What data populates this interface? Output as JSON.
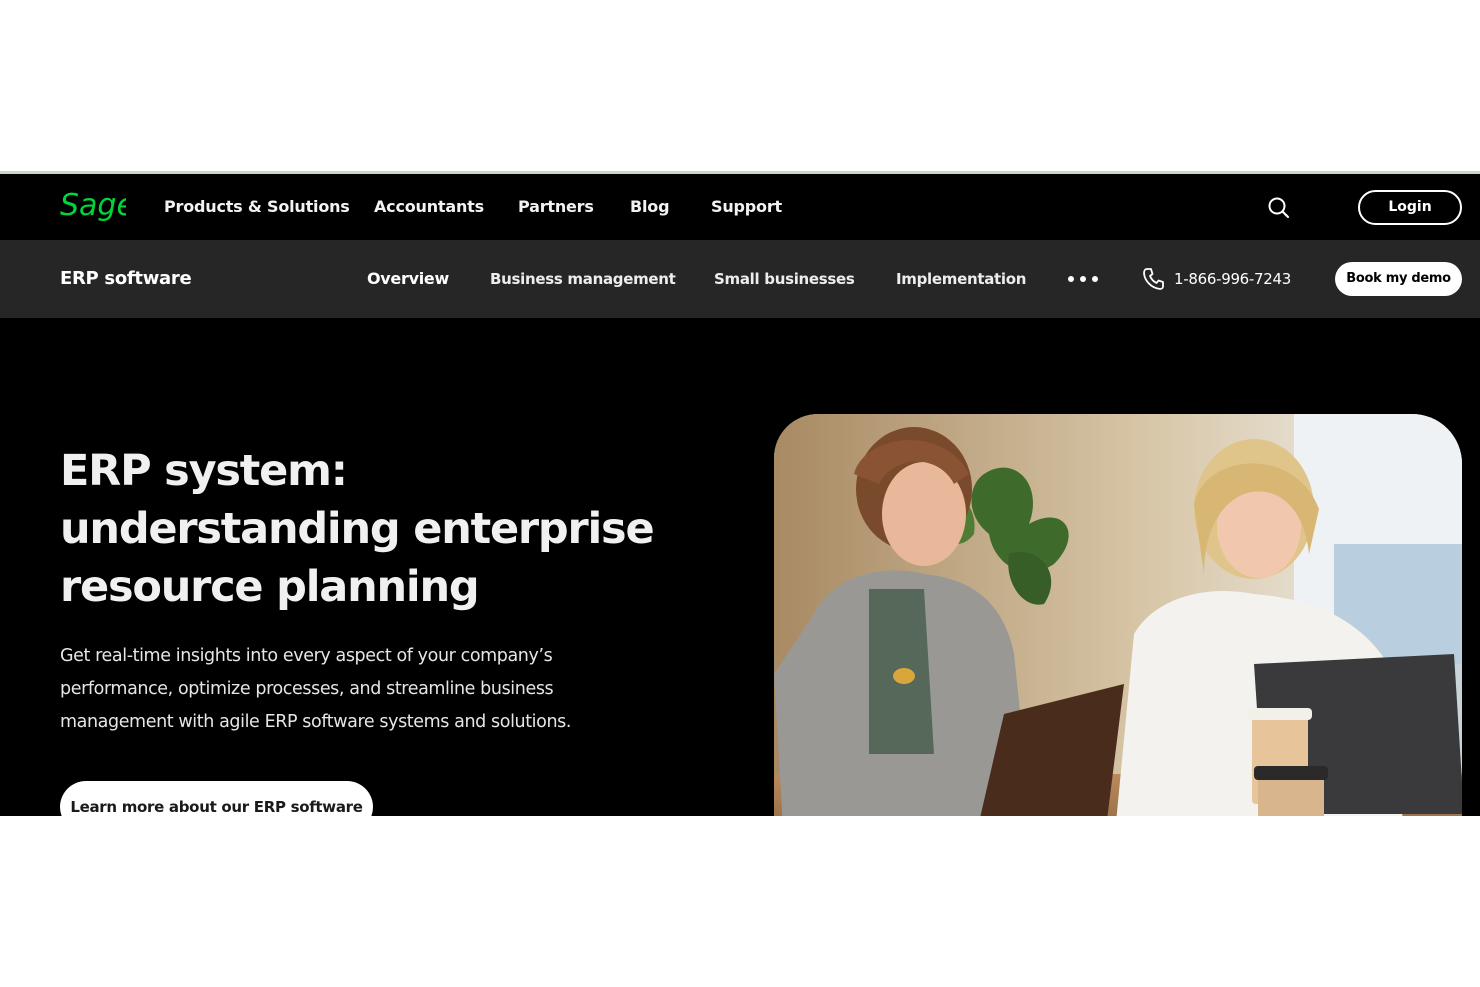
{
  "brand": {
    "logo_text": "Sage",
    "accent_color": "#00d639"
  },
  "primary_nav": {
    "items": [
      "Products & Solutions",
      "Accountants",
      "Partners",
      "Blog",
      "Support"
    ],
    "login_label": "Login"
  },
  "secondary_nav": {
    "title": "ERP software",
    "items": [
      "Overview",
      "Business management",
      "Small businesses",
      "Implementation"
    ],
    "active_item": "Overview",
    "phone": "1-866-996-7243",
    "demo_label": "Book my demo"
  },
  "hero": {
    "title_lines": [
      "ERP system:",
      "understanding enterprise",
      "resource planning"
    ],
    "description_lines": [
      "Get real-time insights into every aspect of your company’s",
      "performance, optimize processes, and streamline business",
      "management with agile ERP software systems and solutions."
    ],
    "cta_label": "Learn more about our ERP software",
    "image_subject": "two-women-working-at-laptops"
  }
}
